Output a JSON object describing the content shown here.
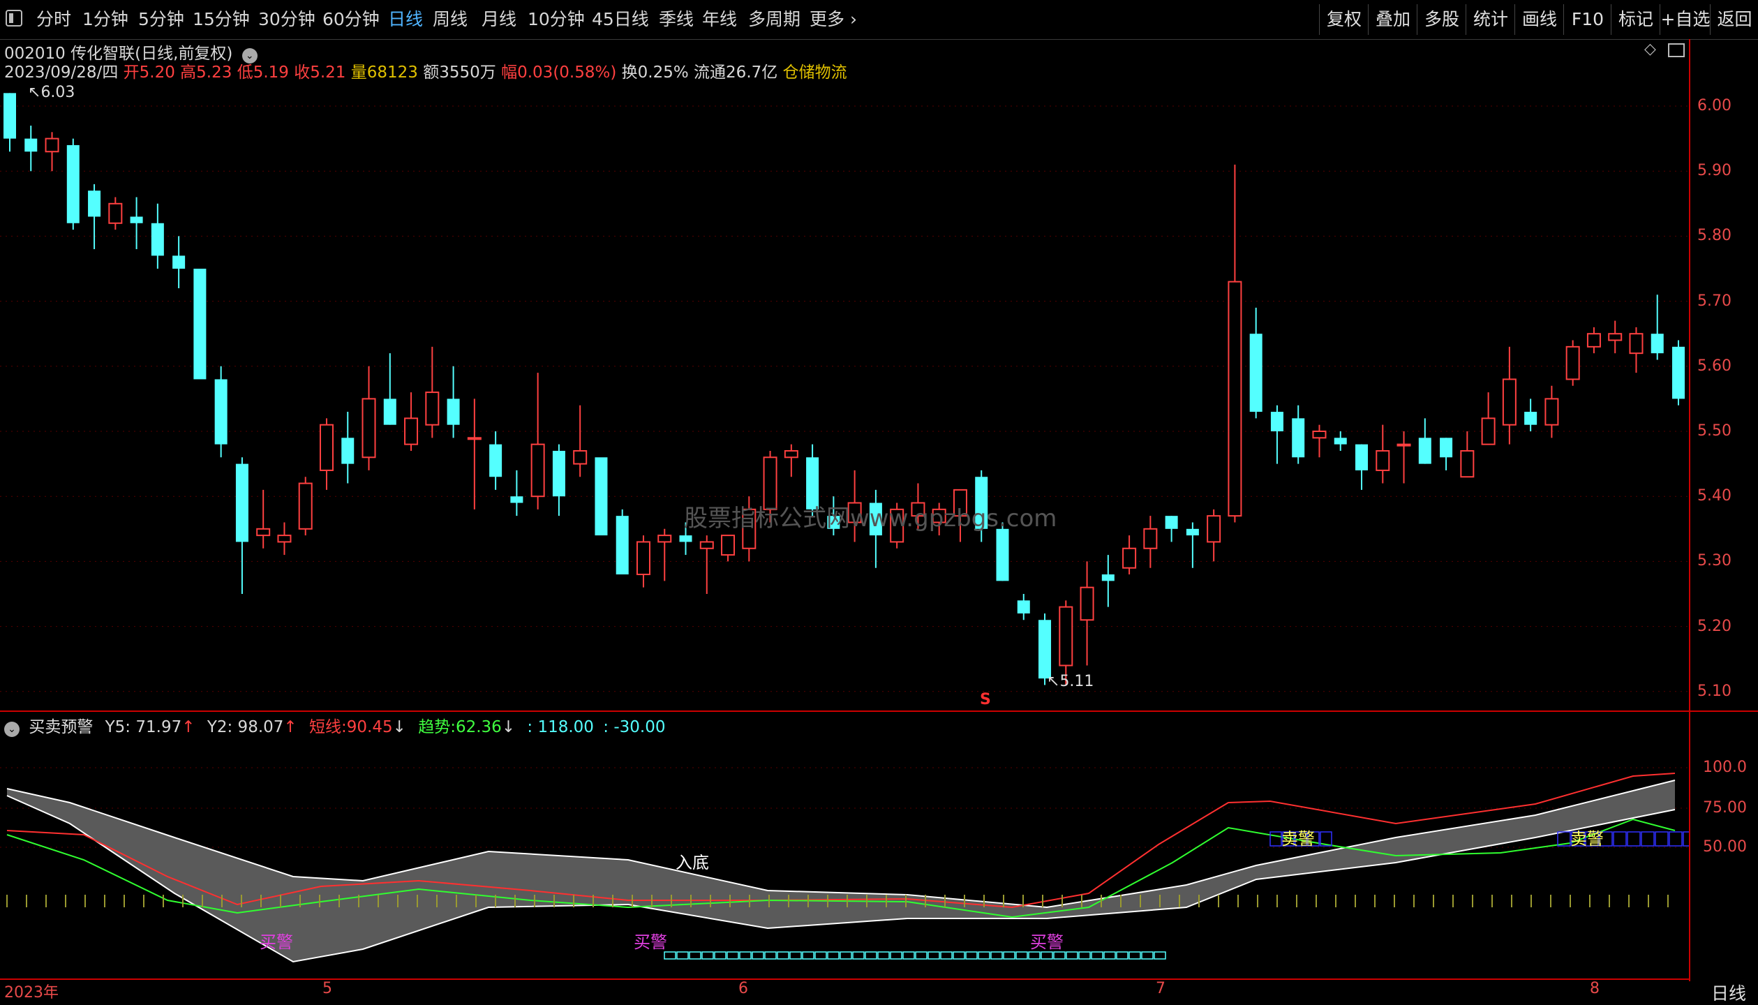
{
  "periods": [
    "分时",
    "1分钟",
    "5分钟",
    "15分钟",
    "30分钟",
    "60分钟",
    "日线",
    "周线",
    "月线",
    "10分钟",
    "45日线",
    "季线",
    "年线",
    "多周期",
    "更多"
  ],
  "active_period": "日线",
  "tools": [
    "复权",
    "叠加",
    "多股",
    "统计",
    "画线",
    "F10",
    "标记",
    "+自选",
    "返回"
  ],
  "stock": {
    "title": "002010 传化智联(日线,前复权)"
  },
  "quote": {
    "date": "2023/09/28/四",
    "open_label": "开",
    "open": "5.20",
    "high_label": "高",
    "high": "5.23",
    "low_label": "低",
    "low": "5.19",
    "close_label": "收",
    "close": "5.21",
    "vol_label": "量",
    "vol": "68123",
    "amount": "额3550万",
    "change_label": "幅",
    "change": "0.03(0.58%)",
    "turnover": "换0.25%",
    "float": "流通26.7亿",
    "sector": "仓储物流"
  },
  "indicator": {
    "name": "买卖预警",
    "y5": "Y5: 71.97",
    "y2": "Y2: 98.07",
    "short_label": "短线:",
    "short_value": "90.45",
    "trend_label": "趋势:",
    "trend_value": "62.36",
    "v1": ": 118.00",
    "v2": ": -30.00"
  },
  "price_axis": [
    "6.00",
    "5.90",
    "5.80",
    "5.70",
    "5.60",
    "5.50",
    "5.40",
    "5.30",
    "5.20",
    "5.10"
  ],
  "indicator_axis": [
    "100.0",
    "75.00",
    "50.00"
  ],
  "x_labels": [
    "2023年",
    "5",
    "6",
    "7",
    "8"
  ],
  "right_tab": "日线",
  "annotations": {
    "high_mark": "6.03",
    "low_mark": "5.11",
    "s_mark": "S",
    "ind_text": [
      "入底",
      "买警",
      "买警",
      "买警",
      "卖警",
      "卖警"
    ]
  },
  "watermark": "股票指标公式网www.gpzbgs.com",
  "colors": {
    "up": "#ff4040",
    "down": "#54ffff",
    "accent": "#4fb4ff",
    "axis": "#e84a4a"
  },
  "candles": [
    [
      6.02,
      6.02,
      5.93,
      5.95
    ],
    [
      5.95,
      5.97,
      5.9,
      5.93
    ],
    [
      5.93,
      5.96,
      5.9,
      5.95
    ],
    [
      5.94,
      5.95,
      5.81,
      5.82
    ],
    [
      5.87,
      5.88,
      5.78,
      5.83
    ],
    [
      5.82,
      5.86,
      5.81,
      5.85
    ],
    [
      5.83,
      5.86,
      5.78,
      5.82
    ],
    [
      5.82,
      5.85,
      5.75,
      5.77
    ],
    [
      5.77,
      5.8,
      5.72,
      5.75
    ],
    [
      5.75,
      5.75,
      5.59,
      5.58
    ],
    [
      5.58,
      5.6,
      5.46,
      5.48
    ],
    [
      5.45,
      5.46,
      5.25,
      5.33
    ],
    [
      5.34,
      5.41,
      5.32,
      5.35
    ],
    [
      5.33,
      5.36,
      5.31,
      5.34
    ],
    [
      5.35,
      5.43,
      5.34,
      5.42
    ],
    [
      5.44,
      5.52,
      5.41,
      5.51
    ],
    [
      5.49,
      5.53,
      5.42,
      5.45
    ],
    [
      5.46,
      5.6,
      5.44,
      5.55
    ],
    [
      5.55,
      5.62,
      5.51,
      5.51
    ],
    [
      5.48,
      5.56,
      5.47,
      5.52
    ],
    [
      5.51,
      5.63,
      5.49,
      5.56
    ],
    [
      5.55,
      5.6,
      5.49,
      5.51
    ],
    [
      5.49,
      5.55,
      5.38,
      5.49
    ],
    [
      5.48,
      5.5,
      5.41,
      5.43
    ],
    [
      5.4,
      5.44,
      5.37,
      5.39
    ],
    [
      5.4,
      5.59,
      5.38,
      5.48
    ],
    [
      5.47,
      5.48,
      5.37,
      5.4
    ],
    [
      5.45,
      5.54,
      5.43,
      5.47
    ],
    [
      5.46,
      5.45,
      5.38,
      5.34
    ],
    [
      5.37,
      5.38,
      5.28,
      5.28
    ],
    [
      5.28,
      5.34,
      5.26,
      5.33
    ],
    [
      5.33,
      5.35,
      5.27,
      5.34
    ],
    [
      5.34,
      5.36,
      5.31,
      5.33
    ],
    [
      5.32,
      5.34,
      5.25,
      5.33
    ],
    [
      5.31,
      5.33,
      5.3,
      5.34
    ],
    [
      5.32,
      5.4,
      5.3,
      5.38
    ],
    [
      5.38,
      5.47,
      5.36,
      5.46
    ],
    [
      5.46,
      5.48,
      5.43,
      5.47
    ],
    [
      5.46,
      5.48,
      5.37,
      5.38
    ],
    [
      5.37,
      5.4,
      5.34,
      5.35
    ],
    [
      5.36,
      5.44,
      5.33,
      5.39
    ],
    [
      5.39,
      5.41,
      5.29,
      5.34
    ],
    [
      5.33,
      5.39,
      5.32,
      5.38
    ],
    [
      5.37,
      5.42,
      5.35,
      5.39
    ],
    [
      5.36,
      5.39,
      5.34,
      5.38
    ],
    [
      5.37,
      5.41,
      5.33,
      5.41
    ],
    [
      5.43,
      5.44,
      5.33,
      5.35
    ],
    [
      5.35,
      5.36,
      5.27,
      5.27
    ],
    [
      5.24,
      5.25,
      5.21,
      5.22
    ],
    [
      5.21,
      5.22,
      5.11,
      5.12
    ],
    [
      5.14,
      5.24,
      5.11,
      5.23
    ],
    [
      5.21,
      5.3,
      5.14,
      5.26
    ],
    [
      5.28,
      5.31,
      5.23,
      5.27
    ],
    [
      5.29,
      5.34,
      5.28,
      5.32
    ],
    [
      5.32,
      5.37,
      5.29,
      5.35
    ],
    [
      5.37,
      5.37,
      5.33,
      5.35
    ],
    [
      5.35,
      5.36,
      5.29,
      5.34
    ],
    [
      5.33,
      5.38,
      5.3,
      5.37
    ],
    [
      5.37,
      5.91,
      5.36,
      5.73
    ],
    [
      5.65,
      5.69,
      5.52,
      5.53
    ],
    [
      5.53,
      5.54,
      5.45,
      5.5
    ],
    [
      5.52,
      5.54,
      5.45,
      5.46
    ],
    [
      5.49,
      5.51,
      5.46,
      5.5
    ],
    [
      5.49,
      5.5,
      5.47,
      5.48
    ],
    [
      5.48,
      5.48,
      5.41,
      5.44
    ],
    [
      5.44,
      5.51,
      5.42,
      5.47
    ],
    [
      5.48,
      5.5,
      5.42,
      5.48
    ],
    [
      5.49,
      5.52,
      5.45,
      5.45
    ],
    [
      5.49,
      5.49,
      5.44,
      5.46
    ],
    [
      5.43,
      5.5,
      5.43,
      5.47
    ],
    [
      5.48,
      5.56,
      5.48,
      5.52
    ],
    [
      5.51,
      5.63,
      5.48,
      5.58
    ],
    [
      5.53,
      5.55,
      5.5,
      5.51
    ],
    [
      5.51,
      5.57,
      5.49,
      5.55
    ],
    [
      5.58,
      5.64,
      5.57,
      5.63
    ],
    [
      5.63,
      5.66,
      5.62,
      5.65
    ],
    [
      5.64,
      5.67,
      5.62,
      5.65
    ],
    [
      5.62,
      5.66,
      5.59,
      5.65
    ],
    [
      5.65,
      5.71,
      5.61,
      5.62
    ],
    [
      5.63,
      5.64,
      5.54,
      5.55
    ]
  ],
  "buy_markers_x": [
    0.105,
    0.245,
    0.618
  ],
  "sell_markers_x": [
    0.76,
    0.935
  ]
}
